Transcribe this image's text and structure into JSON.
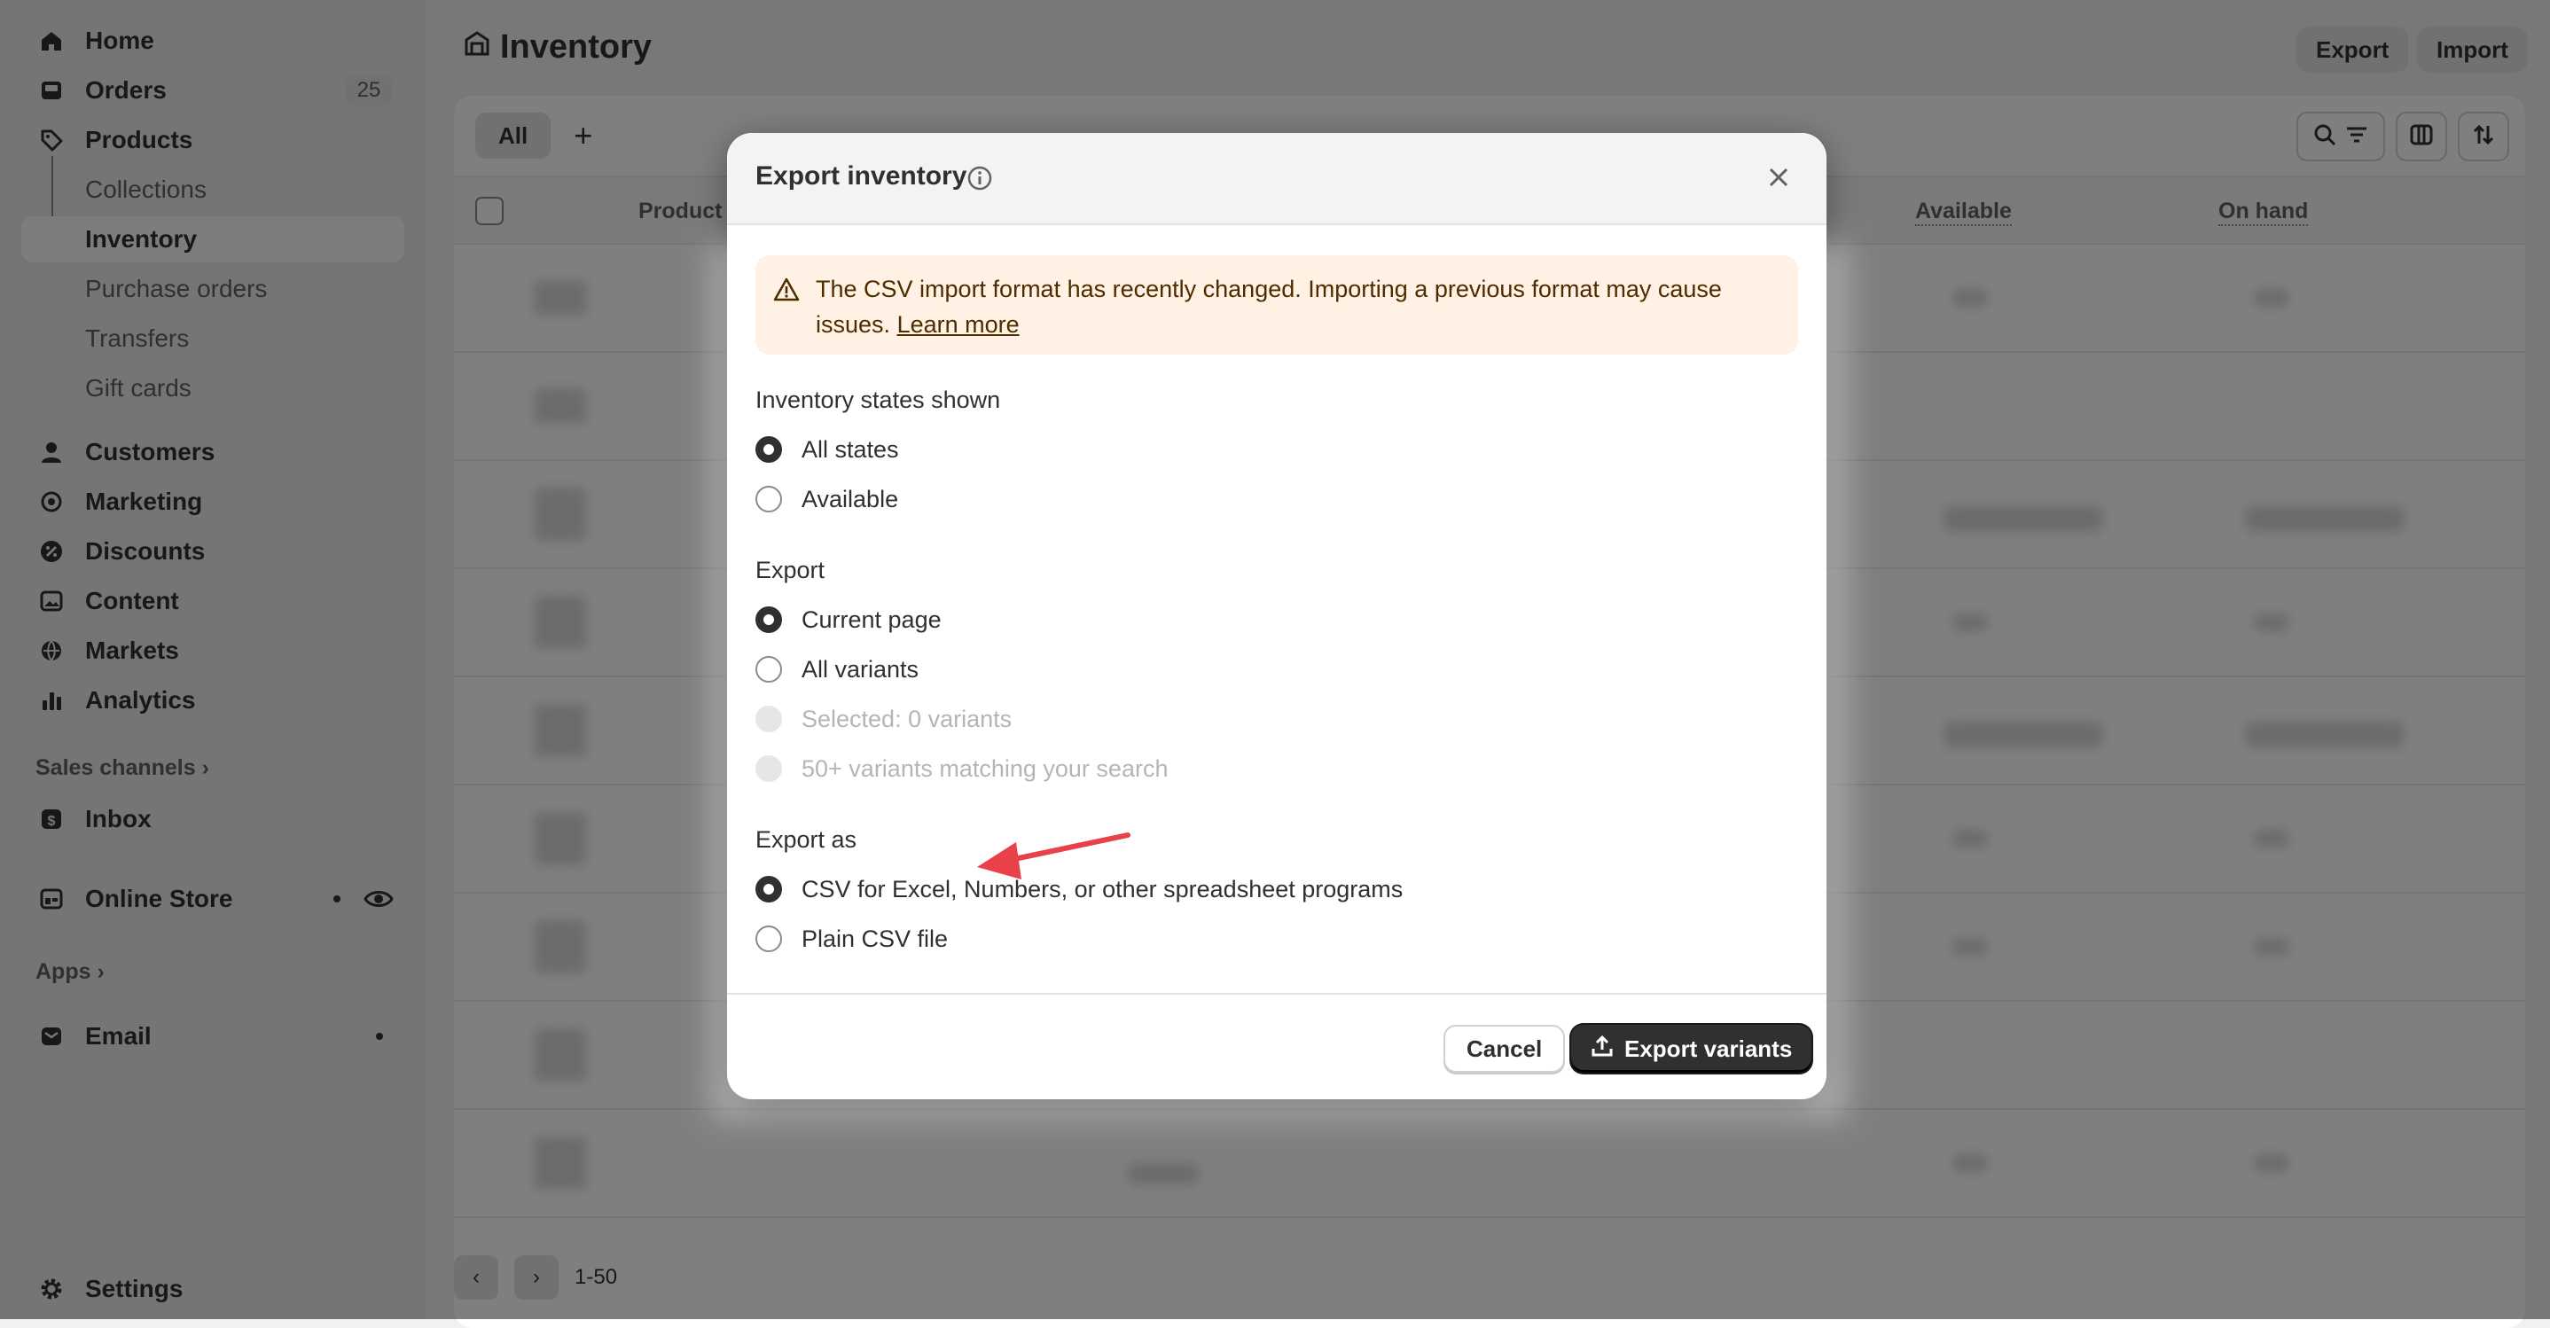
{
  "sidebar": {
    "home": "Home",
    "orders": "Orders",
    "orders_count": "25",
    "products": "Products",
    "collections": "Collections",
    "inventory": "Inventory",
    "purchase_orders": "Purchase orders",
    "transfers": "Transfers",
    "gift_cards": "Gift cards",
    "customers": "Customers",
    "marketing": "Marketing",
    "discounts": "Discounts",
    "content": "Content",
    "markets": "Markets",
    "analytics": "Analytics",
    "sales_channels": "Sales channels",
    "inbox": "Inbox",
    "online_store": "Online Store",
    "apps": "Apps",
    "email": "Email",
    "settings": "Settings"
  },
  "header": {
    "title": "Inventory",
    "export_label": "Export",
    "import_label": "Import"
  },
  "table": {
    "tab_all": "All",
    "col_product": "Product",
    "col_available": "Available",
    "col_on_hand": "On hand",
    "pagination": "1-50"
  },
  "modal": {
    "title": "Export inventory",
    "banner_text": "The CSV import format has recently changed. Importing a previous format may cause issues.",
    "banner_link": "Learn more",
    "states_label": "Inventory states shown",
    "states_options": [
      "All states",
      "Available"
    ],
    "states_selected": "All states",
    "export_label": "Export",
    "export_options": [
      "Current page",
      "All variants",
      "Selected: 0 variants",
      "50+ variants matching your search"
    ],
    "export_selected": "Current page",
    "format_label": "Export as",
    "format_options": [
      "CSV for Excel, Numbers, or other spreadsheet programs",
      "Plain CSV file"
    ],
    "format_selected": "CSV for Excel, Numbers, or other spreadsheet programs",
    "cancel_label": "Cancel",
    "submit_label": "Export variants"
  },
  "colors": {
    "annotation_arrow": "#e8414a",
    "banner_bg": "#fff1e3",
    "primary_button": "#303030"
  }
}
